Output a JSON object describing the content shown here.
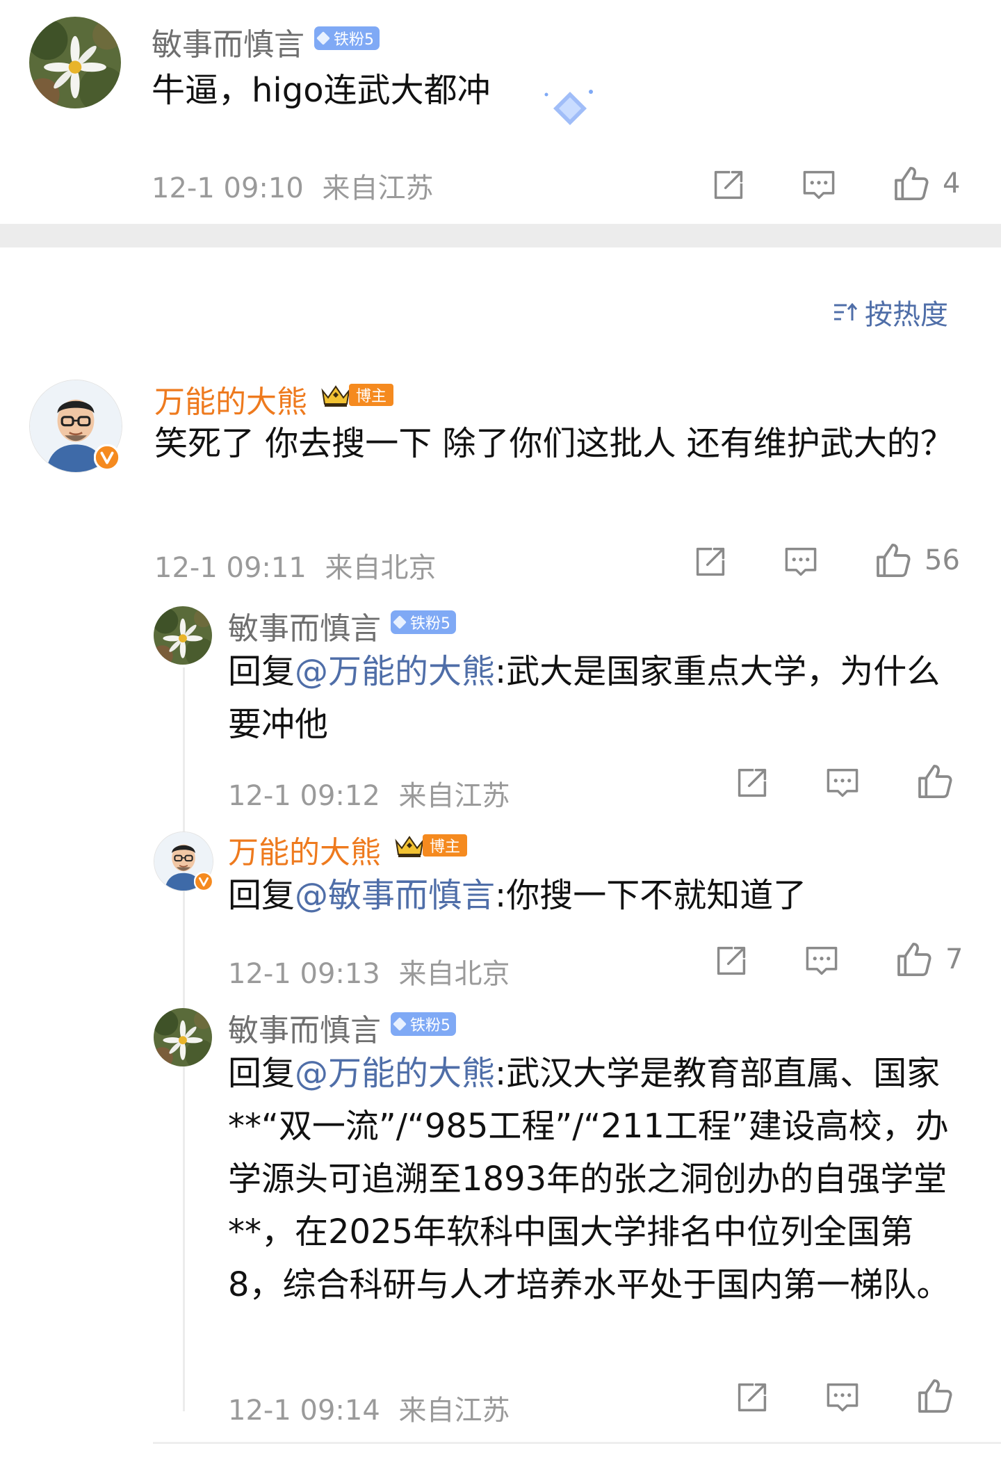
{
  "comments": [
    {
      "user": "敏事而慎言",
      "badge": "铁粉5",
      "text": "牛逼，higo连武大都冲",
      "time": "12-1 09:10",
      "location": "来自江苏",
      "likes": "4"
    },
    {
      "user": "万能的大熊",
      "badge": "博主",
      "text": "笑死了 你去搜一下 除了你们这批人 还有维护武大的？",
      "time": "12-1 09:11",
      "location": "来自北京",
      "likes": "56",
      "replies": [
        {
          "user": "敏事而慎言",
          "badge": "铁粉5",
          "reply_prefix": "回复",
          "mention": "@万能的大熊",
          "text": ":武大是国家重点大学，为什么要冲他",
          "time": "12-1 09:12",
          "location": "来自江苏",
          "likes": ""
        },
        {
          "user": "万能的大熊",
          "badge": "博主",
          "reply_prefix": "回复",
          "mention": "@敏事而慎言",
          "text": ":你搜一下不就知道了",
          "time": "12-1 09:13",
          "location": "来自北京",
          "likes": "7"
        },
        {
          "user": "敏事而慎言",
          "badge": "铁粉5",
          "reply_prefix": "回复",
          "mention": "@万能的大熊",
          "text": ":武汉大学是教育部直属、国家**“双一流”/“985工程”/“211工程”建设高校，办学源头可追溯至1893年的张之洞创办的自强学堂**，在2025年软科中国大学排名中位列全国第8，综合科研与人才培养水平处于国内第一梯队。",
          "time": "12-1 09:14",
          "location": "来自江苏",
          "likes": ""
        }
      ]
    }
  ],
  "sort": {
    "label": "按热度",
    "icon": "sort-icon"
  },
  "icons": {
    "share": "share-icon",
    "comment": "comment-icon",
    "like": "thumbs-up-icon"
  },
  "colors": {
    "username_fan": "#6f6f6f",
    "username_host": "#ee7a1e",
    "mention": "#4f6ea8",
    "fan_badge": "#7fa9f5",
    "host_badge": "#f58a1f",
    "meta": "#9a9a9a",
    "sort": "#4f6ea8",
    "separator": "#ececec"
  }
}
